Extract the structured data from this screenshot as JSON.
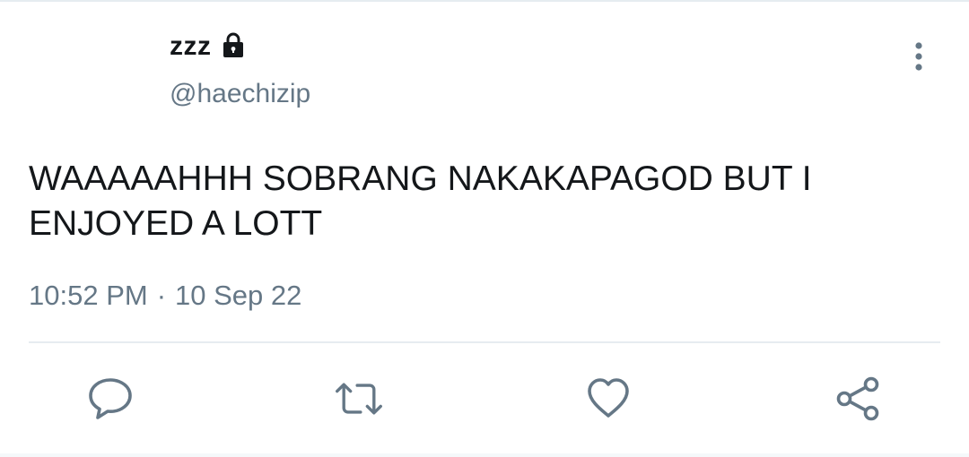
{
  "author": {
    "display_name": "zzz",
    "handle": "@haechizip",
    "protected": true
  },
  "tweet": {
    "text": "WAAAAAHHH SOBRANG NAKAKAPAGOD BUT I ENJOYED A LOTT",
    "time": "10:52 PM",
    "separator": "·",
    "date": "10 Sep 22"
  },
  "actions": {
    "reply_icon": "reply-icon",
    "retweet_icon": "retweet-icon",
    "like_icon": "heart-icon",
    "share_icon": "share-icon",
    "more_icon": "more-vertical-icon"
  },
  "colors": {
    "text_primary": "#14171a",
    "text_secondary": "#657786",
    "icon": "#657786",
    "divider": "#e6ecf0"
  }
}
